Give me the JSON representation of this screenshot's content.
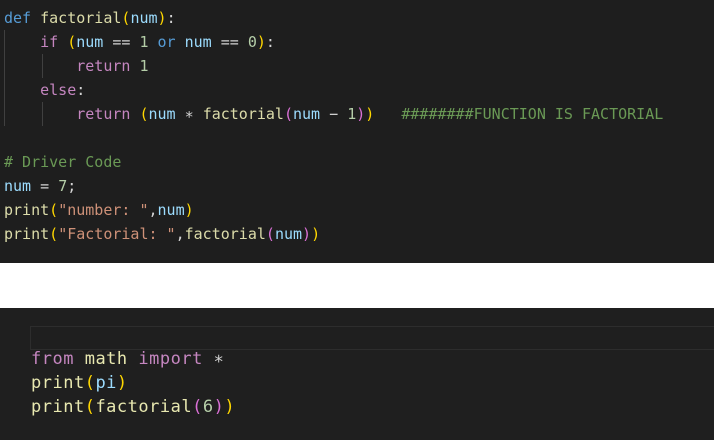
{
  "editor_top": {
    "lines": [
      [
        {
          "t": "def",
          "c": "kw"
        },
        {
          "t": " ",
          "c": "pun"
        },
        {
          "t": "factorial",
          "c": "fn"
        },
        {
          "t": "(",
          "c": "br1"
        },
        {
          "t": "num",
          "c": "var"
        },
        {
          "t": ")",
          "c": "br1"
        },
        {
          "t": ":",
          "c": "pun"
        }
      ],
      [
        {
          "t": "    ",
          "c": "pun"
        },
        {
          "t": "if",
          "c": "ctrl"
        },
        {
          "t": " ",
          "c": "pun"
        },
        {
          "t": "(",
          "c": "br1"
        },
        {
          "t": "num",
          "c": "var"
        },
        {
          "t": " == ",
          "c": "pun"
        },
        {
          "t": "1",
          "c": "num"
        },
        {
          "t": " ",
          "c": "pun"
        },
        {
          "t": "or",
          "c": "kw"
        },
        {
          "t": " ",
          "c": "pun"
        },
        {
          "t": "num",
          "c": "var"
        },
        {
          "t": " == ",
          "c": "pun"
        },
        {
          "t": "0",
          "c": "num"
        },
        {
          "t": ")",
          "c": "br1"
        },
        {
          "t": ":",
          "c": "pun"
        }
      ],
      [
        {
          "t": "        ",
          "c": "pun"
        },
        {
          "t": "return",
          "c": "ctrl"
        },
        {
          "t": " ",
          "c": "pun"
        },
        {
          "t": "1",
          "c": "num"
        }
      ],
      [
        {
          "t": "    ",
          "c": "pun"
        },
        {
          "t": "else",
          "c": "ctrl"
        },
        {
          "t": ":",
          "c": "pun"
        }
      ],
      [
        {
          "t": "        ",
          "c": "pun"
        },
        {
          "t": "return",
          "c": "ctrl"
        },
        {
          "t": " ",
          "c": "pun"
        },
        {
          "t": "(",
          "c": "br1"
        },
        {
          "t": "num",
          "c": "var"
        },
        {
          "t": " ∗ ",
          "c": "pun"
        },
        {
          "t": "factorial",
          "c": "fn"
        },
        {
          "t": "(",
          "c": "br2"
        },
        {
          "t": "num",
          "c": "var"
        },
        {
          "t": " − ",
          "c": "pun"
        },
        {
          "t": "1",
          "c": "num"
        },
        {
          "t": ")",
          "c": "br2"
        },
        {
          "t": ")",
          "c": "br1"
        },
        {
          "t": "   ",
          "c": "pun"
        },
        {
          "t": "########FUNCTION IS FACTORIAL",
          "c": "cmt"
        }
      ],
      [],
      [
        {
          "t": "# Driver Code",
          "c": "cmt"
        }
      ],
      [
        {
          "t": "num",
          "c": "var"
        },
        {
          "t": " = ",
          "c": "pun"
        },
        {
          "t": "7",
          "c": "num"
        },
        {
          "t": ";",
          "c": "pun"
        }
      ],
      [
        {
          "t": "print",
          "c": "fn"
        },
        {
          "t": "(",
          "c": "br1"
        },
        {
          "t": "\"number: \"",
          "c": "str"
        },
        {
          "t": ",",
          "c": "pun"
        },
        {
          "t": "num",
          "c": "var"
        },
        {
          "t": ")",
          "c": "br1"
        }
      ],
      [
        {
          "t": "print",
          "c": "fn"
        },
        {
          "t": "(",
          "c": "br1"
        },
        {
          "t": "\"Factorial: \"",
          "c": "str"
        },
        {
          "t": ",",
          "c": "pun"
        },
        {
          "t": "factorial",
          "c": "fn"
        },
        {
          "t": "(",
          "c": "br2"
        },
        {
          "t": "num",
          "c": "var"
        },
        {
          "t": ")",
          "c": "br2"
        },
        {
          "t": ")",
          "c": "br1"
        }
      ]
    ]
  },
  "editor_bottom": {
    "lines": [
      [
        {
          "t": "from",
          "c": "ctrl"
        },
        {
          "t": " ",
          "c": "pun"
        },
        {
          "t": "math",
          "c": "fn"
        },
        {
          "t": " ",
          "c": "pun"
        },
        {
          "t": "import",
          "c": "ctrl"
        },
        {
          "t": " ",
          "c": "pun"
        },
        {
          "t": "∗",
          "c": "pun"
        }
      ],
      [
        {
          "t": "print",
          "c": "fn"
        },
        {
          "t": "(",
          "c": "br1"
        },
        {
          "t": "pi",
          "c": "var"
        },
        {
          "t": ")",
          "c": "br1"
        }
      ],
      [
        {
          "t": "print",
          "c": "fn"
        },
        {
          "t": "(",
          "c": "br1"
        },
        {
          "t": "factorial",
          "c": "fn"
        },
        {
          "t": "(",
          "c": "br2"
        },
        {
          "t": "6",
          "c": "num"
        },
        {
          "t": ")",
          "c": "br2"
        },
        {
          "t": ")",
          "c": "br1"
        }
      ]
    ]
  }
}
